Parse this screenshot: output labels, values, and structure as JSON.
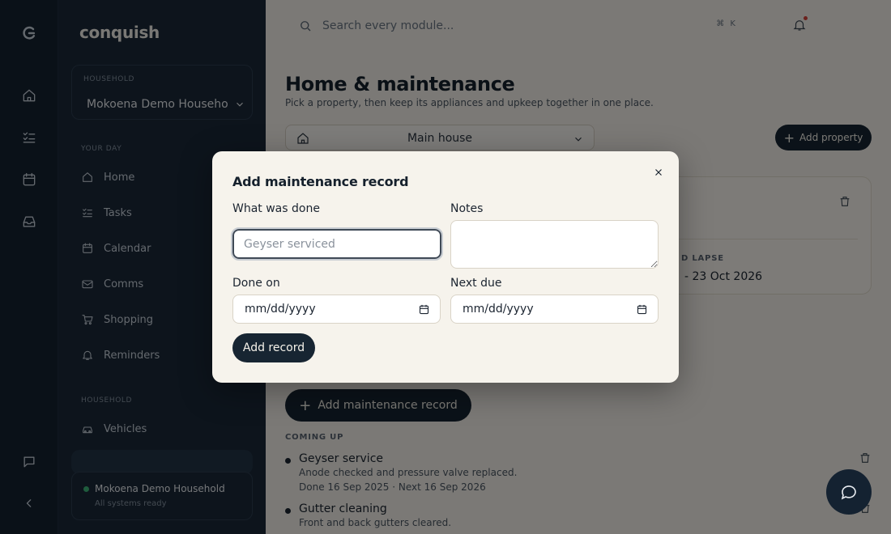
{
  "app": {
    "brand": "conquish"
  },
  "rail": {
    "icons": [
      "logo-icon",
      "home-icon",
      "tasks-icon",
      "calendar-icon",
      "inbox-icon",
      "chat-icon",
      "collapse-icon"
    ]
  },
  "sidebar": {
    "household_label": "HOUSEHOLD",
    "household_name": "Mokoena Demo Household",
    "section_your_day": "YOUR DAY",
    "items": [
      {
        "label": "Home",
        "icon": "home-icon"
      },
      {
        "label": "Tasks",
        "icon": "tasks-icon"
      },
      {
        "label": "Calendar",
        "icon": "calendar-icon"
      },
      {
        "label": "Comms",
        "icon": "mail-icon"
      },
      {
        "label": "Shopping",
        "icon": "cart-icon"
      },
      {
        "label": "Reminders",
        "icon": "bell-icon"
      }
    ],
    "section_household": "HOUSEHOLD",
    "household_items": [
      {
        "label": "Vehicles",
        "icon": "car-icon"
      }
    ],
    "footer": {
      "name": "Mokoena Demo Household",
      "status": "All systems ready"
    }
  },
  "main": {
    "search_placeholder": "Search every module...",
    "shortcut": "⌘ K",
    "title": "Home & maintenance",
    "subtitle": "Pick a property, then keep its appliances and upkeep together in one place.",
    "property_select": "Main house",
    "add_property": "Add property",
    "card": {
      "lapse_label": "D LAPSE",
      "lapse_value": "- 23 Oct 2026"
    },
    "add_maintenance": "Add maintenance record",
    "coming_up_label": "COMING UP",
    "records": [
      {
        "title": "Geyser service",
        "desc": "Anode checked and pressure valve replaced.",
        "dates": "Done 16 Sep 2025 · Next 16 Sep 2026"
      },
      {
        "title": "Gutter cleaning",
        "desc": "Front and back gutters cleared.",
        "dates": ""
      }
    ]
  },
  "modal": {
    "title": "Add maintenance record",
    "what_label": "What was done",
    "what_placeholder": "Geyser serviced",
    "notes_label": "Notes",
    "done_label": "Done on",
    "next_label": "Next due",
    "date_placeholder": "mm/dd/yyyy",
    "submit": "Add record"
  },
  "colors": {
    "accent": "#172532",
    "sidebar": "#1a2838",
    "rail": "#142231",
    "background": "#f6f3ec",
    "status_dot": "#3fb87a",
    "notify_dot": "#d6433b"
  }
}
